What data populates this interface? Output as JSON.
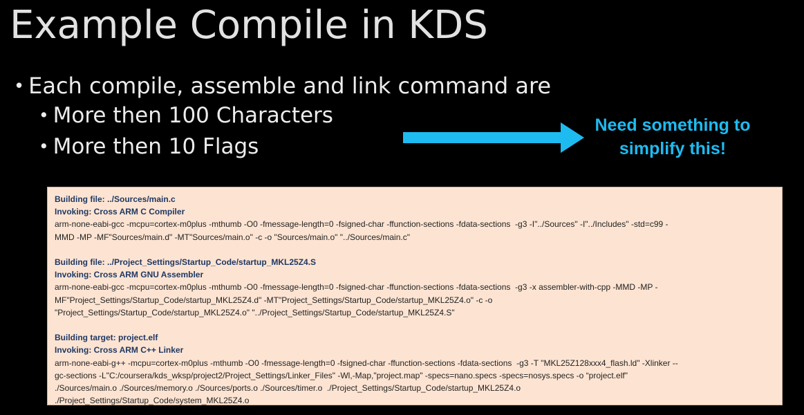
{
  "title": "Example Compile in KDS",
  "bullets": {
    "level1": "Each compile, assemble and link command are",
    "level2": [
      "More then 100 Characters",
      "More then 10 Flags"
    ]
  },
  "callout": {
    "line1": "Need something to",
    "line2": "simplify this!",
    "color": "#1ebbf0"
  },
  "arrow_color": "#1ebbf0",
  "log": {
    "blocks": [
      {
        "building": "Building file: ../Sources/main.c",
        "invoking": "Invoking: Cross ARM C Compiler",
        "lines": [
          "arm-none-eabi-gcc -mcpu=cortex-m0plus -mthumb -O0 -fmessage-length=0 -fsigned-char -ffunction-sections -fdata-sections  -g3 -I\"../Sources\" -I\"../Includes\" -std=c99 -",
          "MMD -MP -MF\"Sources/main.d\" -MT\"Sources/main.o\" -c -o \"Sources/main.o\" \"../Sources/main.c\""
        ]
      },
      {
        "building": "Building file: ../Project_Settings/Startup_Code/startup_MKL25Z4.S",
        "invoking": "Invoking: Cross ARM GNU Assembler",
        "lines": [
          "arm-none-eabi-gcc -mcpu=cortex-m0plus -mthumb -O0 -fmessage-length=0 -fsigned-char -ffunction-sections -fdata-sections  -g3 -x assembler-with-cpp -MMD -MP -",
          "MF\"Project_Settings/Startup_Code/startup_MKL25Z4.d\" -MT\"Project_Settings/Startup_Code/startup_MKL25Z4.o\" -c -o",
          "\"Project_Settings/Startup_Code/startup_MKL25Z4.o\" \"../Project_Settings/Startup_Code/startup_MKL25Z4.S\""
        ]
      },
      {
        "building": "Building target: project.elf",
        "invoking": "Invoking: Cross ARM C++ Linker",
        "lines": [
          "arm-none-eabi-g++ -mcpu=cortex-m0plus -mthumb -O0 -fmessage-length=0 -fsigned-char -ffunction-sections -fdata-sections  -g3 -T \"MKL25Z128xxx4_flash.ld\" -Xlinker --",
          "gc-sections -L\"C:/coursera/kds_wksp/project2/Project_Settings/Linker_Files\" -Wl,-Map,\"project.map\" -specs=nano.specs -specs=nosys.specs -o “project.elf\"",
          "./Sources/main.o ./Sources/memory.o ./Sources/ports.o ./Sources/timer.o  ./Project_Settings/Startup_Code/startup_MKL25Z4.o",
          "./Project_Settings/Startup_Code/system_MKL25Z4.o"
        ]
      }
    ]
  }
}
